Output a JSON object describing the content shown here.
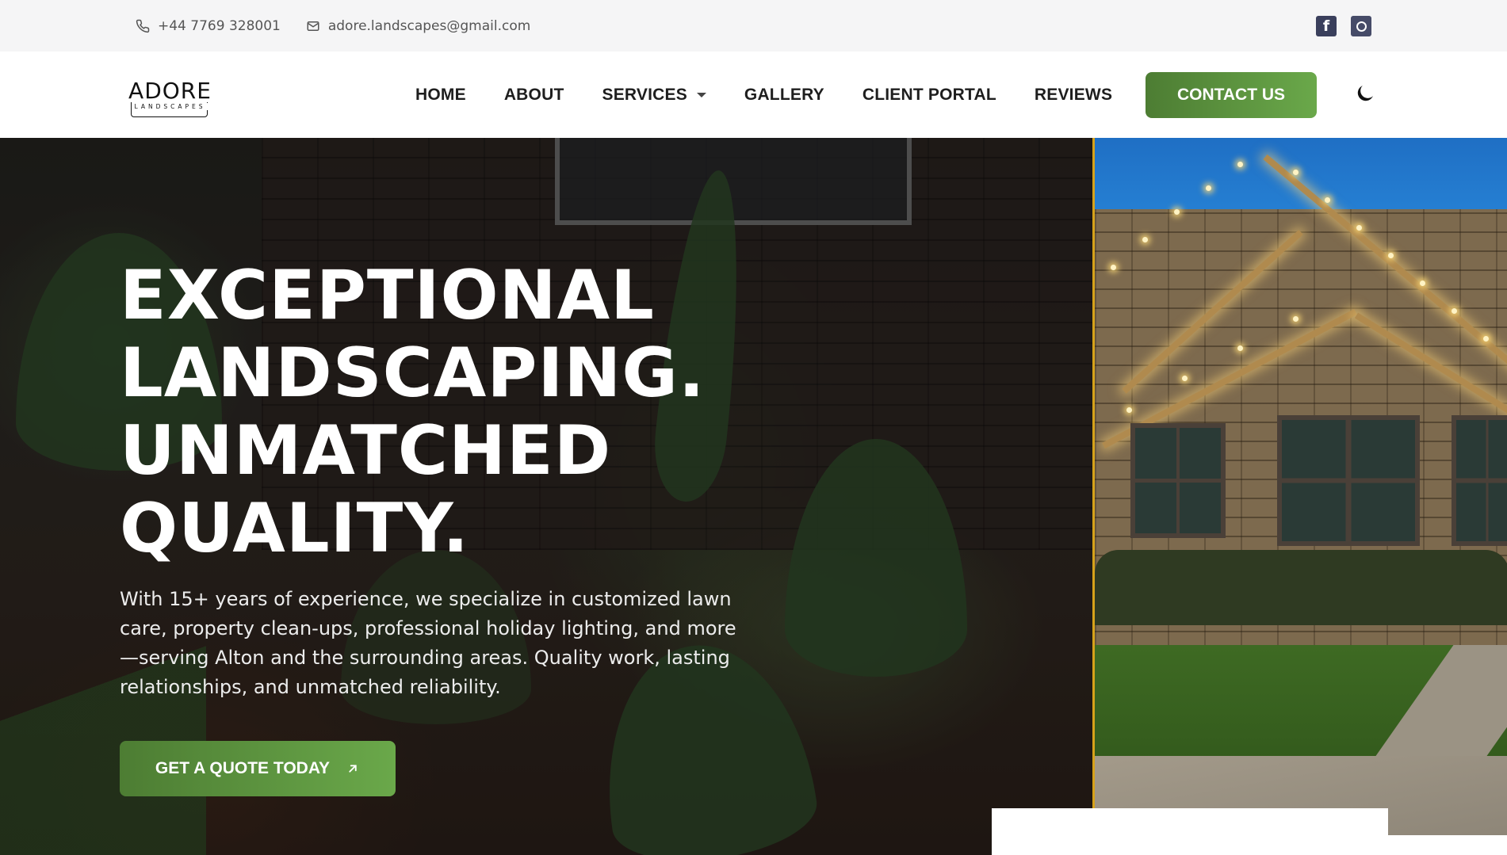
{
  "topbar": {
    "phone": "+44 7769 328001",
    "email": "adore.landscapes@gmail.com",
    "icons": {
      "phone": "phone-icon",
      "email": "mail-icon",
      "facebook": "facebook-icon",
      "instagram": "instagram-icon"
    }
  },
  "logo": {
    "word": "ADORE",
    "sub": "LANDSCAPES"
  },
  "nav": {
    "items": [
      {
        "label": "HOME"
      },
      {
        "label": "ABOUT"
      },
      {
        "label": "SERVICES"
      },
      {
        "label": "GALLERY"
      },
      {
        "label": "CLIENT PORTAL"
      },
      {
        "label": "REVIEWS"
      }
    ],
    "contact_button": "CONTACT US",
    "theme_icon": "moon-icon"
  },
  "hero": {
    "title_lines": [
      "EXCEPTIONAL",
      "LANDSCAPING.",
      "UNMATCHED",
      "QUALITY."
    ],
    "description": "With 15+ years of experience, we specialize in customized lawn care, property clean-ups, professional holiday lighting, and more—serving Alton and the surrounding areas. Quality work, lasting relationships, and unmatched reliability.",
    "cta_label": "GET A QUOTE TODAY",
    "cta_icon": "arrow-up-right-icon"
  },
  "colors": {
    "accent_green": "#5a9140",
    "topbar_bg": "#f5f5f6",
    "divider_gold": "#d6a21a"
  }
}
